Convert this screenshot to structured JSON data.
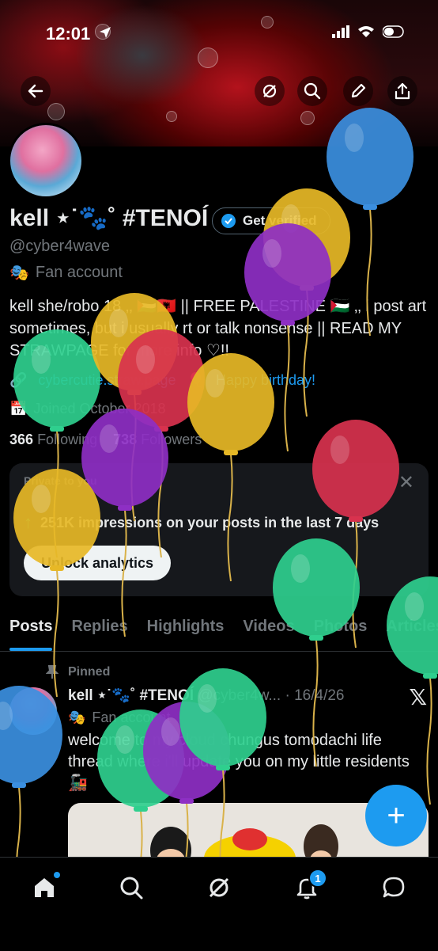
{
  "status": {
    "time": "12:01"
  },
  "profile": {
    "name": "kell ⋆˙🐾˚ #TENOÍ",
    "verify_label": "Get verified",
    "handle": "@cyber4wave",
    "category": "Fan account",
    "bio": "kell she/robo 18 ‚‚ 🇵🇸🇦🇱 || FREE PALESTINE 🇵🇸 ‚‚ i post art sometimes, but i usually rt or talk nonsense || READ MY STRAWPAGE for more info ♡!!",
    "link": "cybercutie.straw.page",
    "birthday": "Happy birthday!",
    "joined": "Joined October 2018",
    "following_count": "366",
    "following_label": "Following",
    "followers_count": "738",
    "followers_label": "Followers"
  },
  "analytics": {
    "private_label": "Private to you",
    "impressions": "251K impressions on your posts in the last 7 days",
    "unlock_label": "Unlock analytics"
  },
  "tabs": [
    {
      "label": "Posts"
    },
    {
      "label": "Replies"
    },
    {
      "label": "Highlights"
    },
    {
      "label": "Videos"
    },
    {
      "label": "Photos"
    },
    {
      "label": "Articles"
    }
  ],
  "pinned_post": {
    "pinned_label": "Pinned",
    "author": "kell ⋆˙🐾˚ #TENOÍ",
    "handle": "@cyber4w...",
    "date": "· 16/4/26",
    "category": "Fan account",
    "text": "welcome to my cloud chungus tomodachi life thread where i'll update you on my little residents 🚂"
  },
  "nav": {
    "notifications_badge": "1"
  },
  "colors": {
    "accent": "#1d9bf0",
    "background": "#000000",
    "muted": "#71767b"
  },
  "balloons": [
    {
      "color": "#3b8fe0"
    },
    {
      "color": "#e7b826"
    },
    {
      "color": "#8e2fc4"
    },
    {
      "color": "#2fcf8e"
    },
    {
      "color": "#e7b826"
    },
    {
      "color": "#d8324e"
    },
    {
      "color": "#e7b826"
    },
    {
      "color": "#8e2fc4"
    },
    {
      "color": "#d8324e"
    },
    {
      "color": "#e7b826"
    },
    {
      "color": "#2fcf8e"
    },
    {
      "color": "#2fcf8e"
    },
    {
      "color": "#3b8fe0"
    },
    {
      "color": "#2fcf8e"
    },
    {
      "color": "#8e2fc4"
    },
    {
      "color": "#2fcf8e"
    }
  ]
}
